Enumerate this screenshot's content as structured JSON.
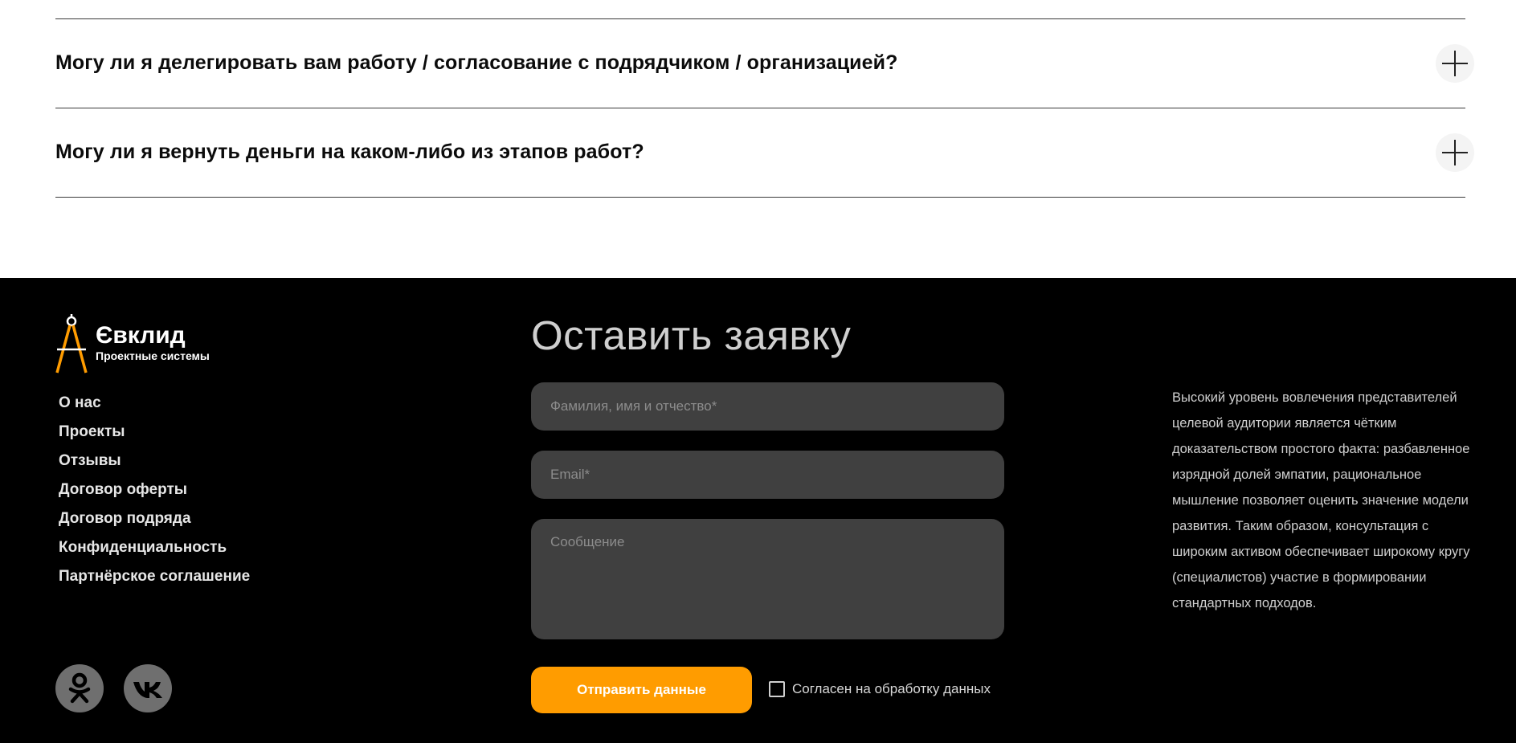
{
  "faq": {
    "items": [
      {
        "question": "Могу ли я делегировать вам работу / согласование с подрядчиком / организацией?"
      },
      {
        "question": "Могу ли я вернуть деньги на каком-либо из этапов работ?"
      }
    ]
  },
  "footer": {
    "logo": {
      "title": "Євклид",
      "subtitle": "Проектные системы"
    },
    "menu": [
      {
        "label": "О нас"
      },
      {
        "label": "Проекты"
      },
      {
        "label": "Отзывы"
      },
      {
        "label": "Договор оферты"
      },
      {
        "label": "Договор подряда"
      },
      {
        "label": "Конфиденциальность"
      },
      {
        "label": "Партнёрское соглашение"
      }
    ],
    "social": [
      {
        "icon": "odnoklassniki-icon"
      },
      {
        "icon": "vk-icon"
      }
    ],
    "form": {
      "title": "Оставить заявку",
      "name_placeholder": "Фамилия, имя и отчество*",
      "email_placeholder": "Email*",
      "message_placeholder": "Сообщение",
      "submit_label": "Отправить данные",
      "consent_label": "Согласен на обработку данных",
      "consent_checked": false
    },
    "about_text": "Высокий уровень вовлечения представителей целевой аудитории является чётким доказательством простого факта: разбавленное изрядной долей эмпатии, рациональное мышление позволяет оценить значение модели развития. Таким образом, консультация с широким активом обеспечивает широкому кругу (специалистов) участие в формировании стандартных подходов."
  },
  "colors": {
    "accent": "#ff9c00",
    "footer_bg": "#000000",
    "field_bg": "#404040",
    "social_bg": "#6f6f6f"
  }
}
